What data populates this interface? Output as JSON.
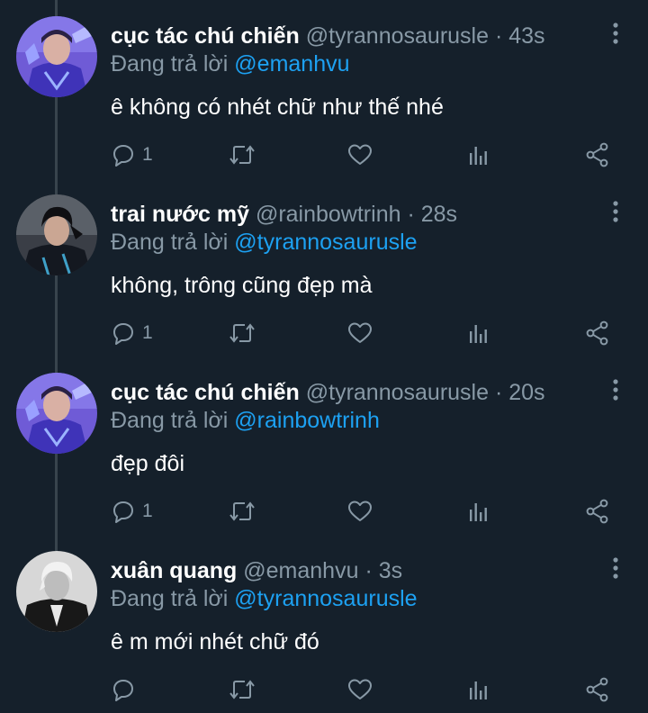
{
  "tweets": [
    {
      "name": "cục tác chú chiến",
      "handle": "@tyrannosaurusle",
      "dot": "·",
      "time": "43s",
      "reply_prefix": "Đang trả lời",
      "reply_to": "@emanhvu",
      "text": "ê không có nhét chữ như thế nhé",
      "reply_count": "1",
      "avatar_theme": "blue"
    },
    {
      "name": "trai nước mỹ",
      "handle": "@rainbowtrinh",
      "dot": "·",
      "time": "28s",
      "reply_prefix": "Đang trả lời",
      "reply_to": "@tyrannosaurusle",
      "text": "không, trông cũng đẹp mà",
      "reply_count": "1",
      "avatar_theme": "dark"
    },
    {
      "name": "cục tác chú chiến",
      "handle": "@tyrannosaurusle",
      "dot": "·",
      "time": "20s",
      "reply_prefix": "Đang trả lời",
      "reply_to": "@rainbowtrinh",
      "text": "đẹp đôi",
      "reply_count": "1",
      "avatar_theme": "blue"
    },
    {
      "name": "xuân quang",
      "handle": "@emanhvu",
      "dot": "·",
      "time": "3s",
      "reply_prefix": "Đang trả lời",
      "reply_to": "@tyrannosaurusle",
      "text": "ê m mới nhét chữ đó",
      "reply_count": "",
      "avatar_theme": "mono"
    }
  ],
  "icons": {
    "reply": "reply-icon",
    "retweet": "retweet-icon",
    "like": "like-icon",
    "analytics": "analytics-icon",
    "share": "share-icon",
    "more": "more-icon"
  },
  "colors": {
    "background": "#15202b",
    "secondary_text": "#8899a6",
    "link": "#1da1f2",
    "thread_line": "#38444d"
  }
}
